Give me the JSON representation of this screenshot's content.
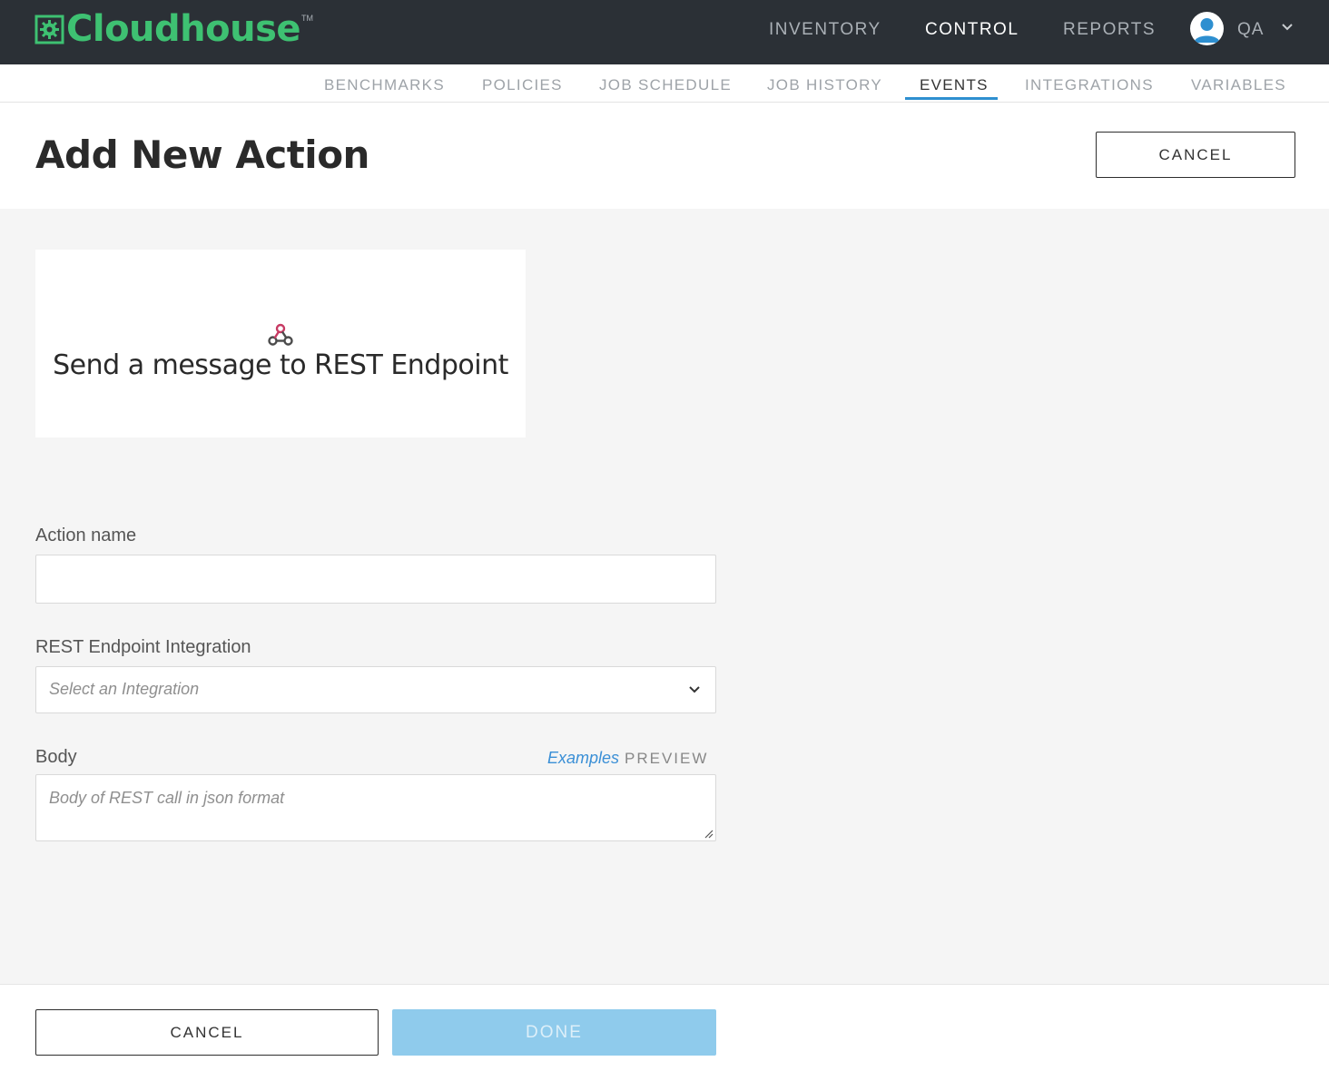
{
  "app": {
    "brand": "Cloudhouse",
    "trademark": "TM",
    "brand_color": "#3ec172"
  },
  "main_nav": [
    {
      "label": "INVENTORY",
      "active": false
    },
    {
      "label": "CONTROL",
      "active": true
    },
    {
      "label": "REPORTS",
      "active": false
    }
  ],
  "user": {
    "name": "QA",
    "icon": "user-avatar-icon"
  },
  "sub_nav": [
    {
      "label": "BENCHMARKS",
      "active": false
    },
    {
      "label": "POLICIES",
      "active": false
    },
    {
      "label": "JOB SCHEDULE",
      "active": false
    },
    {
      "label": "JOB HISTORY",
      "active": false
    },
    {
      "label": "EVENTS",
      "active": true
    },
    {
      "label": "INTEGRATIONS",
      "active": false
    },
    {
      "label": "VARIABLES",
      "active": false
    }
  ],
  "header": {
    "title": "Add New Action",
    "cancel_label": "CANCEL"
  },
  "action_card": {
    "icon": "webhook-icon",
    "title": "Send a message to REST Endpoint"
  },
  "form": {
    "action_name": {
      "label": "Action name",
      "value": ""
    },
    "integration": {
      "label": "REST Endpoint Integration",
      "placeholder": "Select an Integration"
    },
    "body": {
      "label": "Body",
      "examples_label": "Examples",
      "preview_label": "PREVIEW",
      "placeholder": "Body of REST call in json format"
    }
  },
  "footer": {
    "cancel_label": "CANCEL",
    "done_label": "DONE"
  },
  "colors": {
    "topbar": "#2b3036",
    "accent_blue": "#2e8fd0",
    "done_disabled": "#8fcbec"
  }
}
